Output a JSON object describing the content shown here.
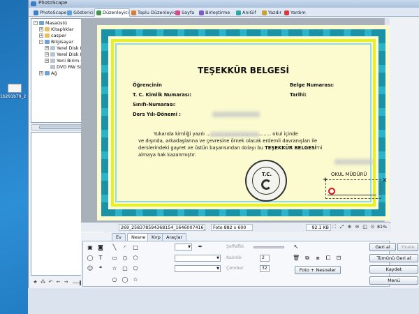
{
  "desktop": {
    "icon_label": "1b291b79_25"
  },
  "window": {
    "title": "PhotoScape"
  },
  "tabs": [
    {
      "label": "PhotoScape",
      "color": "#3a7dc9"
    },
    {
      "label": "Gösterici",
      "color": "#5aa0e0"
    },
    {
      "label": "Düzenleyici",
      "color": "#3d9b45",
      "active": true
    },
    {
      "label": "Toplu Düzenleyici",
      "color": "#e07a2e"
    },
    {
      "label": "Sayfa",
      "color": "#d84a8c"
    },
    {
      "label": "Birleştirme",
      "color": "#7a5cc9"
    },
    {
      "label": "AniGif",
      "color": "#2aa7a0"
    },
    {
      "label": "Yazdır",
      "color": "#c9a22e"
    },
    {
      "label": "Yardım",
      "color": "#d83a3a"
    }
  ],
  "tree": [
    {
      "label": "Masaüstü",
      "level": 0,
      "expander": "-",
      "kind": "pc"
    },
    {
      "label": "Kitaplıklar",
      "level": 1,
      "expander": "+",
      "kind": "folder"
    },
    {
      "label": "casper",
      "level": 1,
      "expander": "+",
      "kind": "folder"
    },
    {
      "label": "Bilgisayar",
      "level": 1,
      "expander": "-",
      "kind": "pc"
    },
    {
      "label": "Yerel Disk (C:)",
      "level": 2,
      "expander": "+",
      "kind": "drive"
    },
    {
      "label": "Yerel Disk (D:)",
      "level": 2,
      "expander": "+",
      "kind": "drive"
    },
    {
      "label": "Yeni Birim (E:)",
      "level": 2,
      "expander": "+",
      "kind": "drive"
    },
    {
      "label": "DVD RW Sürücüsü",
      "level": 2,
      "expander": "",
      "kind": "drive"
    },
    {
      "label": "Ağ",
      "level": 1,
      "expander": "+",
      "kind": "pc"
    }
  ],
  "certificate": {
    "title": "TEŞEKKÜR BELGESİ",
    "f_ogrencinin": "Öğrencinin",
    "f_tc": "T. C. Kimlik Numarası:",
    "f_sinifi": "Sınıfı-Numarası:",
    "f_ders": "Ders Yılı-Dönemi :",
    "f_belge": "Belge Numarası:",
    "f_tarihi": "Tarihi:",
    "body1": "Yukarıda kimliği yazılı ........................................... okul içinde",
    "body2": "ve dışında, arkadaşlarına ve çevresine örnek olacak erdemli davranışları ile",
    "body3a": "derslerindeki gayret ve üstün başarısından dolayı bu",
    "body3b": "TEŞEKKÜR BELGESİ",
    "body3c": "'ni",
    "body4": "almaya hak kazanmıştır.",
    "seal_text": "T.C.",
    "principal": "OKUL MÜDÜRÜ"
  },
  "status": {
    "filename": "269_258378594368154_1646007416_",
    "photo_size": "Foto 882 x 600",
    "file_size": "92.1 KB",
    "zoom": "81%"
  },
  "panel": {
    "tabs": [
      "Ev",
      "Nesne",
      "Kırp",
      "Araçlar"
    ],
    "active_tab": "Nesne",
    "seffaflik": "Şeffaflık",
    "kalinlik": "Kalınlık",
    "kalinlik_value": "2",
    "cember": "Çember",
    "cember_value": "32",
    "foto_nesneler": "Foto + Nesneler",
    "geri_al": "Geri al",
    "yinele": "Yinele",
    "tumunu_geri_al": "Tümünü Geri al",
    "kaydet": "Kaydet",
    "menu": "Menü"
  }
}
